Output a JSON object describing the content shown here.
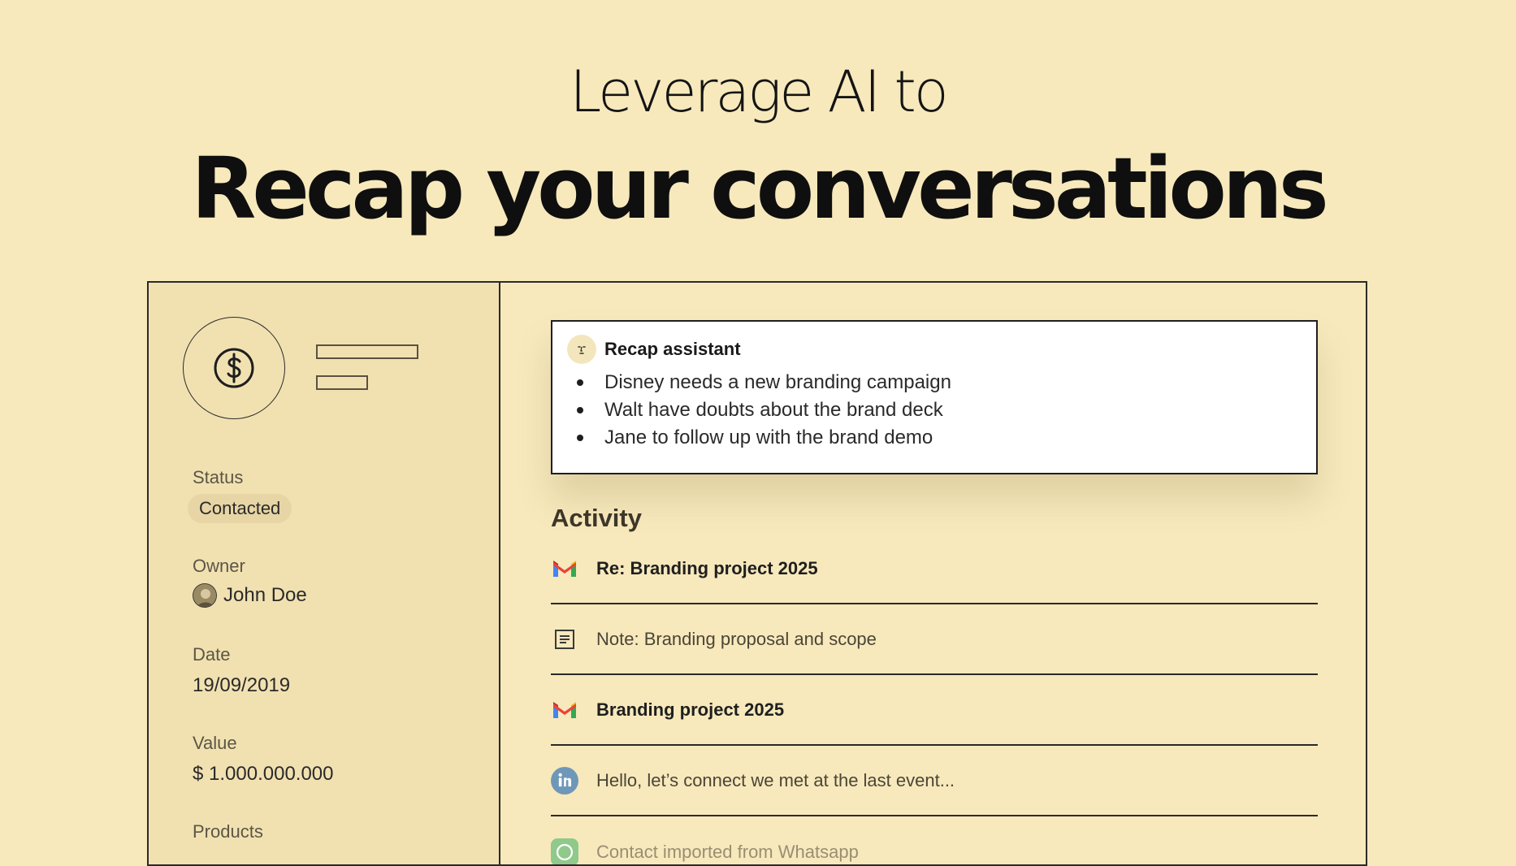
{
  "hero": {
    "subtitle": "Leverage AI to",
    "title": "Recap your conversations"
  },
  "sidebar": {
    "status": {
      "label": "Status",
      "value": "Contacted"
    },
    "owner": {
      "label": "Owner",
      "value": "John Doe"
    },
    "date": {
      "label": "Date",
      "value": "19/09/2019"
    },
    "value": {
      "label": "Value",
      "value": "$ 1.000.000.000"
    },
    "products": {
      "label": "Products"
    }
  },
  "recap": {
    "title": "Recap assistant",
    "items": [
      "Disney needs a new branding campaign",
      "Walt have doubts about the brand deck",
      "Jane to follow up with the brand demo"
    ]
  },
  "activity": {
    "title": "Activity",
    "items": [
      {
        "icon": "gmail-icon",
        "text": "Re: Branding project 2025"
      },
      {
        "icon": "note-icon",
        "text": "Note: Branding proposal and scope"
      },
      {
        "icon": "gmail-icon",
        "text": "Branding project 2025"
      },
      {
        "icon": "linkedin-icon",
        "text": "Hello, let’s connect we met at the last event..."
      },
      {
        "icon": "whatsapp-icon",
        "text": "Contact imported from Whatsapp"
      }
    ]
  },
  "colors": {
    "background": "#f7e9bc",
    "sidebar": "#f1e1b1",
    "badge": "#e7d5a5",
    "linkedin": "#6f97b8",
    "whatsapp": "#8fc98b"
  }
}
